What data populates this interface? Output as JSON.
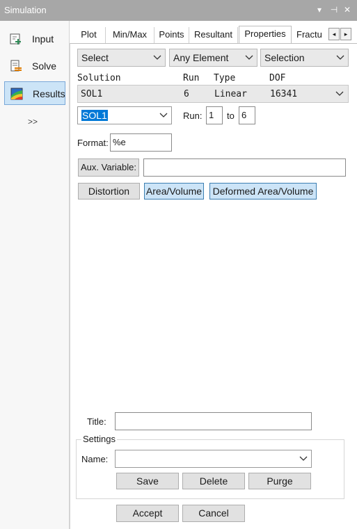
{
  "window": {
    "title": "Simulation",
    "controls": {
      "dropdown": "▾",
      "pin": "⊣",
      "close": "✕"
    }
  },
  "sidebar": {
    "items": [
      {
        "label": "Input",
        "icon": "add-input-icon"
      },
      {
        "label": "Solve",
        "icon": "solve-list-icon"
      },
      {
        "label": "Results",
        "icon": "results-contour-icon"
      }
    ],
    "more_label": ">>"
  },
  "tabs": {
    "items": [
      "Plot",
      "Min/Max",
      "Points",
      "Resultant",
      "Properties",
      "Fractu"
    ],
    "active": "Properties",
    "scroll_left": "◂",
    "scroll_right": "▸"
  },
  "filters": {
    "select": "Select",
    "element": "Any Element",
    "selection": "Selection"
  },
  "solution_table": {
    "headers": {
      "solution": "Solution",
      "run": "Run",
      "type": "Type",
      "dof": "DOF"
    },
    "row": {
      "solution": "SOL1",
      "run": "6",
      "type": "Linear",
      "dof": "16341"
    }
  },
  "run_range": {
    "solution_value": "SOL1",
    "run_label": "Run:",
    "run_from": "1",
    "to_label": "to",
    "run_to": "6"
  },
  "format": {
    "label": "Format:",
    "value": "%e"
  },
  "aux": {
    "button_label": "Aux. Variable:",
    "value": ""
  },
  "options": {
    "distortion": "Distortion",
    "area_volume": "Area/Volume",
    "deformed_area_volume": "Deformed Area/Volume"
  },
  "title_field": {
    "label": "Title:",
    "value": ""
  },
  "settings": {
    "group_label": "Settings",
    "name_label": "Name:",
    "name_value": "",
    "save": "Save",
    "delete": "Delete",
    "purge": "Purge"
  },
  "footer": {
    "accept": "Accept",
    "cancel": "Cancel"
  },
  "colors": {
    "titlebar": "#a7a7a7",
    "selected_fill": "#cce4f7",
    "selected_border": "#3c7fb1",
    "highlight": "#0078d7"
  }
}
